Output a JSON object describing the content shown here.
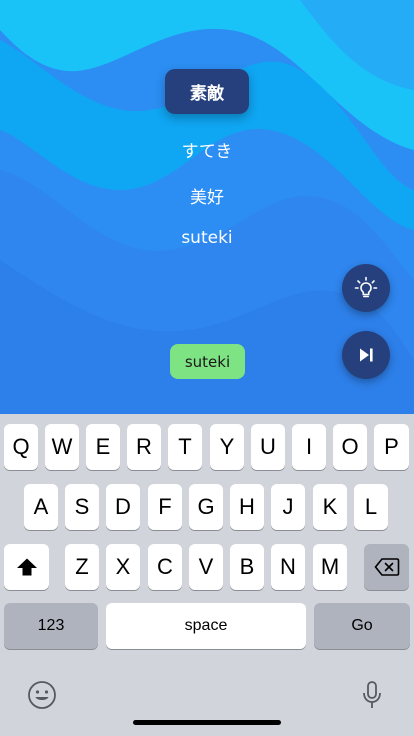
{
  "quiz": {
    "word": "素敵",
    "reading": "すてき",
    "meaning": "美好",
    "romaji": "suteki",
    "answer": "suteki"
  },
  "buttons": {
    "hint_icon": "lightbulb-icon",
    "next_icon": "skip-forward-icon"
  },
  "keyboard": {
    "row1": [
      "Q",
      "W",
      "E",
      "R",
      "T",
      "Y",
      "U",
      "I",
      "O",
      "P"
    ],
    "row2": [
      "A",
      "S",
      "D",
      "F",
      "G",
      "H",
      "J",
      "K",
      "L"
    ],
    "row3": [
      "Z",
      "X",
      "C",
      "V",
      "B",
      "N",
      "M"
    ],
    "numbers_label": "123",
    "space_label": "space",
    "go_label": "Go"
  },
  "colors": {
    "accent_dark": "#25407c",
    "answer_green": "#7ee383",
    "keyboard_bg": "#d1d5db"
  }
}
